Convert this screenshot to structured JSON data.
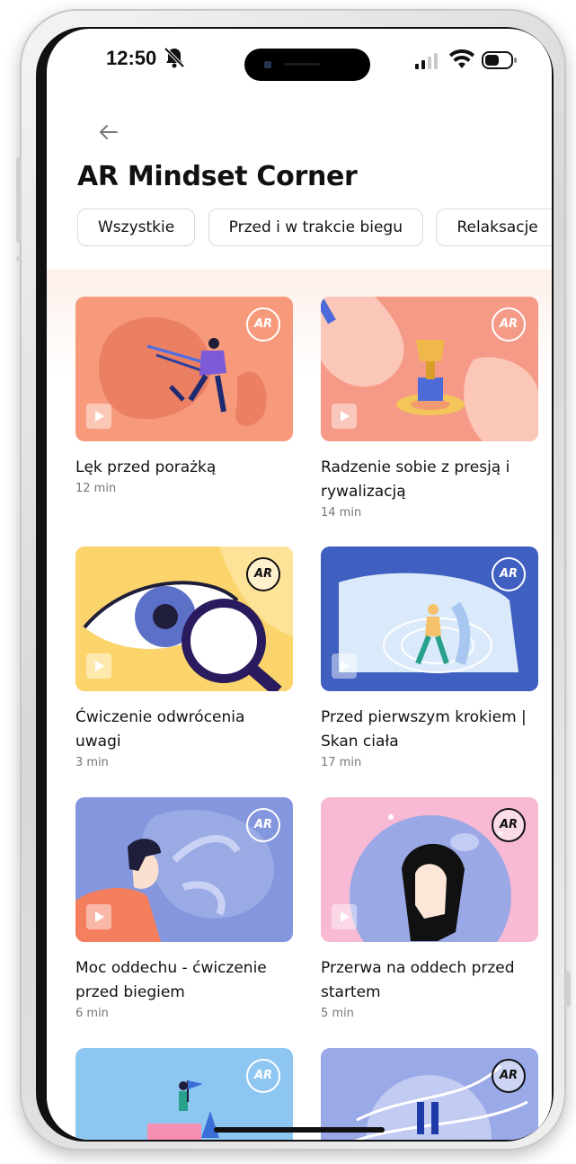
{
  "status_bar": {
    "time": "12:50"
  },
  "header": {
    "title": "AR Mindset Corner"
  },
  "filters": [
    "Wszystkie",
    "Przed i w trakcie biegu",
    "Relaksacje"
  ],
  "logo_text": "AR",
  "items": [
    {
      "title": "Lęk przed porażką",
      "duration": "12 min",
      "color": "#f79a7c"
    },
    {
      "title": "Radzenie sobie z presją i rywalizacją",
      "duration": "14 min",
      "color": "#f59a86"
    },
    {
      "title": "Ćwiczenie odwrócenia uwagi",
      "duration": "3 min",
      "color": "#fbd56b"
    },
    {
      "title": "Przed pierwszym krokiem | Skan ciała",
      "duration": "17 min",
      "color": "#3f5fc1"
    },
    {
      "title": "Moc oddechu - ćwiczenie przed biegiem",
      "duration": "6 min",
      "color": "#8496dd"
    },
    {
      "title": "Przerwa na oddech przed startem",
      "duration": "5 min",
      "color": "#f7b9d3"
    }
  ],
  "partial_items": [
    {
      "color": "#8ec6f2"
    },
    {
      "color": "#9aa9e8"
    }
  ]
}
